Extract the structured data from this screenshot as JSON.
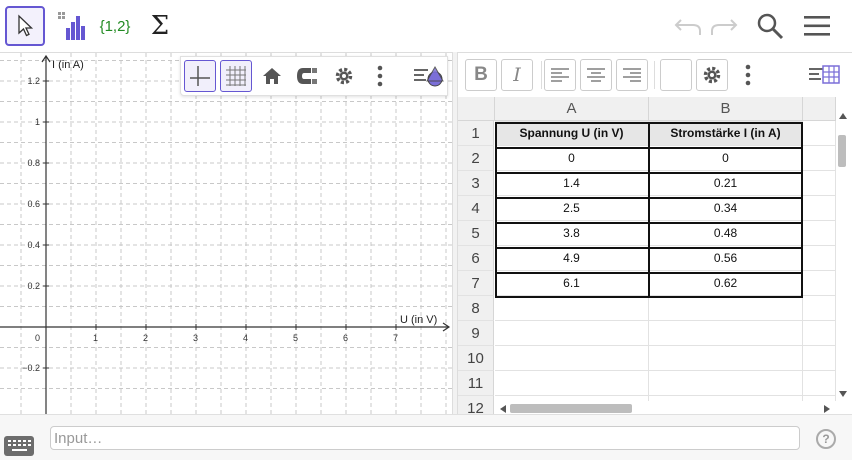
{
  "toolbar": {
    "list_label": "{1,2}",
    "sum_label": "Σ"
  },
  "graphics": {
    "x_axis_label": "U (in V)",
    "y_axis_label": "I (in A)",
    "x_ticks": [
      "0",
      "1",
      "2",
      "3",
      "4",
      "5",
      "6",
      "7"
    ],
    "y_ticks": [
      "−0.2",
      "0.2",
      "0.4",
      "0.6",
      "0.8",
      "1",
      "1.2"
    ],
    "grid_visible": true
  },
  "spreadsheet": {
    "columns": [
      "A",
      "B"
    ],
    "row_numbers": [
      "1",
      "2",
      "3",
      "4",
      "5",
      "6",
      "7",
      "8",
      "9",
      "10",
      "11",
      "12"
    ],
    "rows": [
      [
        "Spannung U (in V)",
        "Stromstärke I (in A)"
      ],
      [
        "0",
        "0"
      ],
      [
        "1.4",
        "0.21"
      ],
      [
        "2.5",
        "0.34"
      ],
      [
        "3.8",
        "0.48"
      ],
      [
        "4.9",
        "0.56"
      ],
      [
        "6.1",
        "0.62"
      ]
    ],
    "bold_label": "B",
    "italic_label": "I"
  },
  "input_bar": {
    "placeholder": "Input…",
    "help_label": "?"
  },
  "colors": {
    "accent": "#6557d2",
    "grid": "#c8c8c8",
    "list_green": "#228b22"
  }
}
